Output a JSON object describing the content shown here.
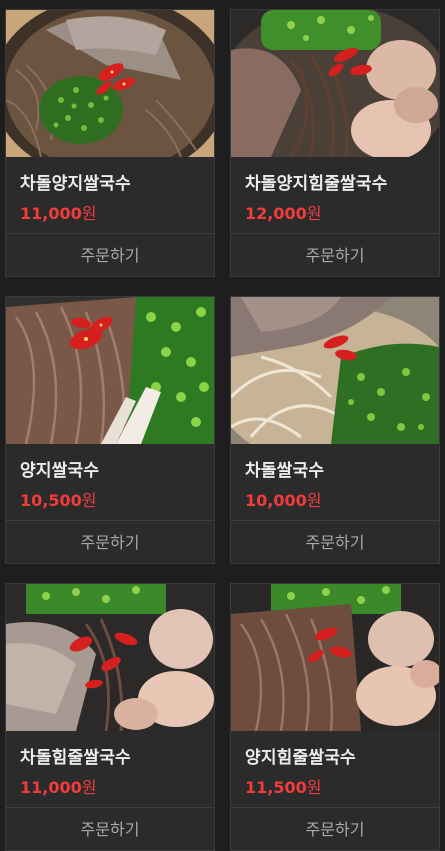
{
  "currency_suffix": "원",
  "order_label": "주문하기",
  "products": [
    {
      "name": "차돌양지쌀국수",
      "price": "11,000",
      "image": "noodle-brisket-herbs"
    },
    {
      "name": "차돌양지힘줄쌀국수",
      "price": "12,000",
      "image": "noodle-brisket-tendon"
    },
    {
      "name": "양지쌀국수",
      "price": "10,500",
      "image": "noodle-shredded-beef"
    },
    {
      "name": "차돌쌀국수",
      "price": "10,000",
      "image": "noodle-brisket-onion"
    },
    {
      "name": "차돌힘줄쌀국수",
      "price": "11,000",
      "image": "noodle-brisket-tendon-2"
    },
    {
      "name": "양지힘줄쌀국수",
      "price": "11,500",
      "image": "noodle-shredded-tendon"
    }
  ],
  "colors": {
    "background": "#1e1e1e",
    "card": "#2b2b2c",
    "price": "#f23c3c",
    "name": "#ededed",
    "order_text": "#a9a9ab"
  }
}
